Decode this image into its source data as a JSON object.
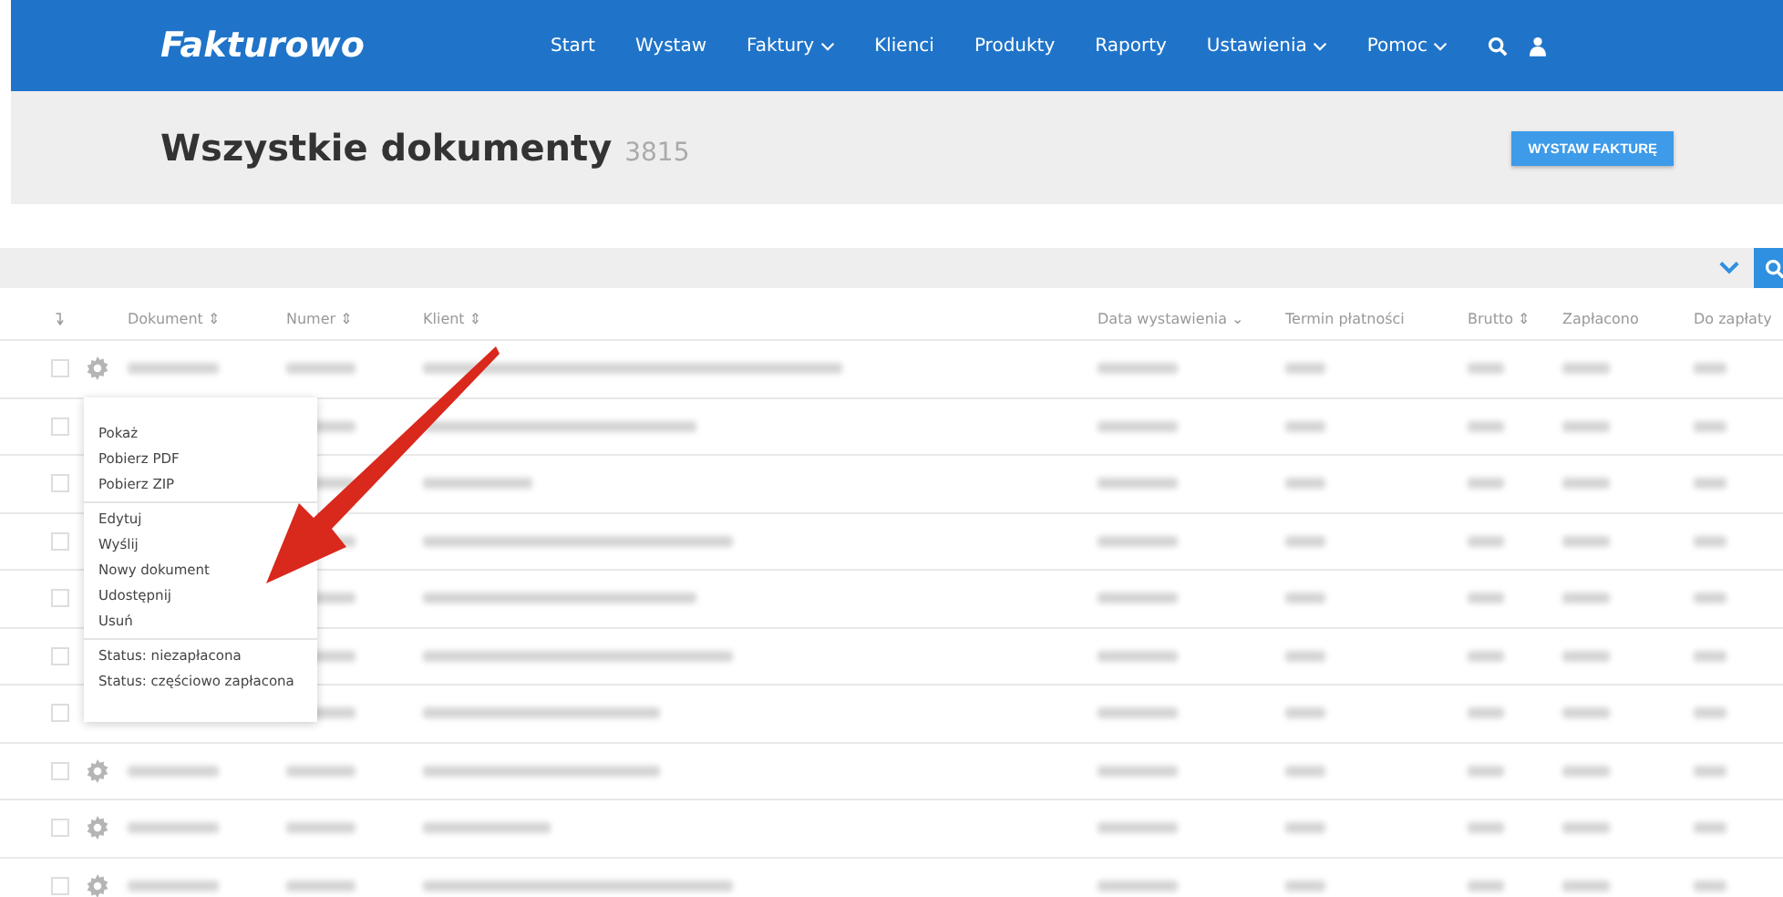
{
  "brand": "Fakturowo",
  "nav": [
    {
      "label": "Start",
      "dropdown": false
    },
    {
      "label": "Wystaw",
      "dropdown": false
    },
    {
      "label": "Faktury",
      "dropdown": true
    },
    {
      "label": "Klienci",
      "dropdown": false
    },
    {
      "label": "Produkty",
      "dropdown": false
    },
    {
      "label": "Raporty",
      "dropdown": false
    },
    {
      "label": "Ustawienia",
      "dropdown": true
    },
    {
      "label": "Pomoc",
      "dropdown": true
    }
  ],
  "page": {
    "title": "Wszystkie dokumenty",
    "count": "3815",
    "button": "WYSTAW FAKTURĘ"
  },
  "table": {
    "columns": [
      "Dokument ⇕",
      "Numer ⇕",
      "Klient ⇕",
      "Data wystawienia ⌄",
      "Termin płatności",
      "Brutto ⇕",
      "Zapłacono",
      "Do zapłaty"
    ],
    "rows": [
      {
        "checked": false
      },
      {
        "checked": false
      },
      {
        "checked": false
      },
      {
        "checked": false
      },
      {
        "checked": false
      },
      {
        "checked": false
      },
      {
        "checked": false
      },
      {
        "checked": false
      },
      {
        "checked": false
      },
      {
        "checked": false
      }
    ]
  },
  "menu": {
    "groups": [
      [
        "Pokaż",
        "Pobierz PDF",
        "Pobierz ZIP"
      ],
      [
        "Edytuj",
        "Wyślij",
        "Nowy dokument",
        "Udostępnij",
        "Usuń"
      ],
      [
        "Status: niezapłacona",
        "Status: częściowo zapłacona"
      ]
    ]
  }
}
